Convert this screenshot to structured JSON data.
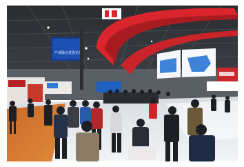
{
  "photo": {
    "banner_text": "产城融合发展论坛",
    "colors": {
      "hall_ceiling": "#1f2124",
      "red_ring": "#d9252b",
      "carpet": "#d8782e",
      "floor": "#e9ecef",
      "screen_blue": "#1c6fd0"
    }
  }
}
